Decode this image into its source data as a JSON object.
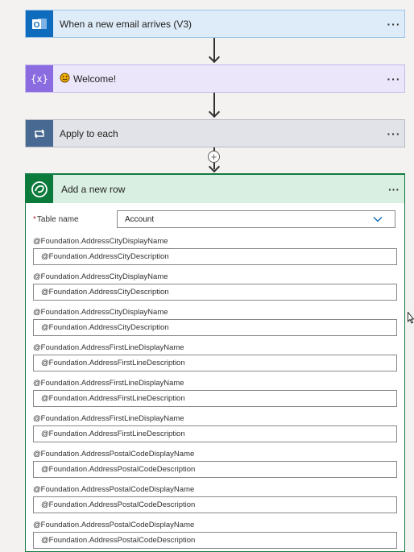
{
  "cards": {
    "email": {
      "title": "When a new email arrives (V3)",
      "more": "···"
    },
    "welcome": {
      "title": "Welcome!",
      "more": "···"
    },
    "apply": {
      "title": "Apply to each",
      "more": "···"
    }
  },
  "insert_step": {
    "symbol": "+"
  },
  "add_row": {
    "title": "Add a new row",
    "more": "···",
    "table_name": {
      "label": "Table name",
      "required_mark": "*",
      "value": "Account"
    },
    "fields": [
      {
        "label": "@Foundation.AddressCityDisplayName",
        "value": "@Foundation.AddressCityDescription"
      },
      {
        "label": "@Foundation.AddressCityDisplayName",
        "value": "@Foundation.AddressCityDescription"
      },
      {
        "label": "@Foundation.AddressCityDisplayName",
        "value": "@Foundation.AddressCityDescription"
      },
      {
        "label": "@Foundation.AddressFirstLineDisplayName",
        "value": "@Foundation.AddressFirstLineDescription"
      },
      {
        "label": "@Foundation.AddressFirstLineDisplayName",
        "value": "@Foundation.AddressFirstLineDescription"
      },
      {
        "label": "@Foundation.AddressFirstLineDisplayName",
        "value": "@Foundation.AddressFirstLineDescription"
      },
      {
        "label": "@Foundation.AddressPostalCodeDisplayName",
        "value": "@Foundation.AddressPostalCodeDescription"
      },
      {
        "label": "@Foundation.AddressPostalCodeDisplayName",
        "value": "@Foundation.AddressPostalCodeDescription"
      },
      {
        "label": "@Foundation.AddressPostalCodeDisplayName",
        "value": "@Foundation.AddressPostalCodeDescription"
      }
    ]
  },
  "colors": {
    "accent_green": "#107c41",
    "outlook_blue": "#0f6cbd",
    "variable_purple": "#8a6be0",
    "loop_slate": "#486991",
    "chevron_blue": "#0f6cbd"
  }
}
